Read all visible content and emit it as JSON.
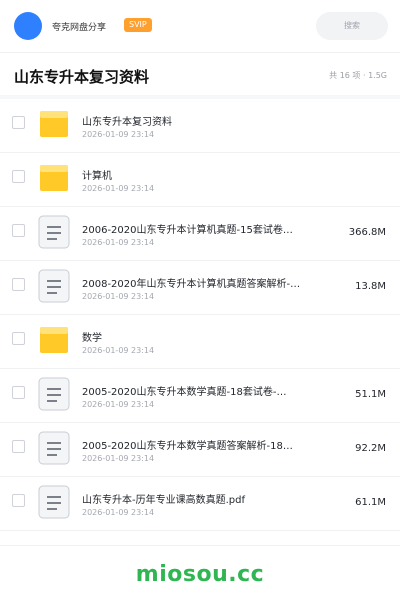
{
  "header": {
    "sharer_name": "夸克网盘分享",
    "badge": "SVIP",
    "search_placeholder": "搜索"
  },
  "folder": {
    "title": "山东专升本复习资料",
    "summary": "共 16 项 · 1.5G"
  },
  "items": [
    {
      "type": "folder",
      "name": "山东专升本复习资料",
      "date": "2026-01-09 23:14",
      "size": ""
    },
    {
      "type": "folder",
      "name": "计算机",
      "date": "2026-01-09 23:14",
      "size": ""
    },
    {
      "type": "file",
      "name": "2006-2020山东专升本计算机真题-15套试卷…",
      "date": "2026-01-09 23:14",
      "size": "366.8M"
    },
    {
      "type": "file",
      "name": "2008-2020年山东专升本计算机真题答案解析-…",
      "date": "2026-01-09 23:14",
      "size": "13.8M"
    },
    {
      "type": "folder",
      "name": "数学",
      "date": "2026-01-09 23:14",
      "size": ""
    },
    {
      "type": "file",
      "name": "2005-2020山东专升本数学真题-18套试卷-…",
      "date": "2026-01-09 23:14",
      "size": "51.1M"
    },
    {
      "type": "file",
      "name": "2005-2020山东专升本数学真题答案解析-18…",
      "date": "2026-01-09 23:14",
      "size": "92.2M"
    },
    {
      "type": "file",
      "name": "山东专升本-历年专业课高数真题.pdf",
      "date": "2026-01-09 23:14",
      "size": "61.1M"
    }
  ],
  "watermark": "miosou.cc",
  "colors": {
    "avatar": "#2f80ff",
    "badge": "#ff9f2e",
    "folder": "#ffc927",
    "watermark": "#2fb552"
  },
  "icons": {
    "folder": "folder-icon",
    "file": "document-icon"
  }
}
